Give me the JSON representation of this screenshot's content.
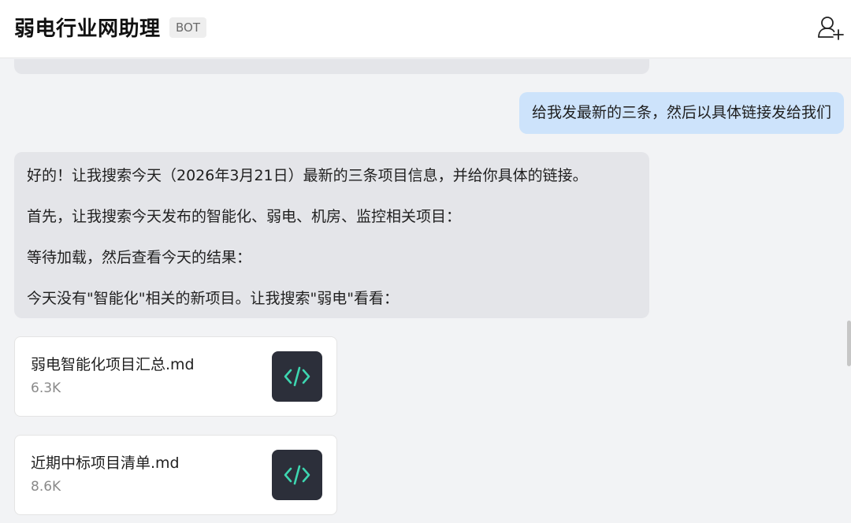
{
  "header": {
    "title": "弱电行业网助理",
    "badge": "BOT",
    "add_user_icon": "add-user-icon"
  },
  "messages": {
    "user": "给我发最新的三条，然后以具体链接发给我们",
    "bot": [
      "好的！让我搜索今天（2026年3月21日）最新的三条项目信息，并给你具体的链接。",
      "首先，让我搜索今天发布的智能化、弱电、机房、监控相关项目：",
      "等待加载，然后查看今天的结果：",
      "今天没有\"智能化\"相关的新项目。让我搜索\"弱电\"看看："
    ]
  },
  "files": [
    {
      "name": "弱电智能化项目汇总.md",
      "size": "6.3K",
      "icon": "code-icon"
    },
    {
      "name": "近期中标项目清单.md",
      "size": "8.6K",
      "icon": "code-icon"
    }
  ],
  "colors": {
    "user_bubble": "#cde3fb",
    "bot_bubble": "#e4e5e9",
    "file_icon_bg": "#2c2f3a",
    "code_icon": "#3dd6b0"
  }
}
